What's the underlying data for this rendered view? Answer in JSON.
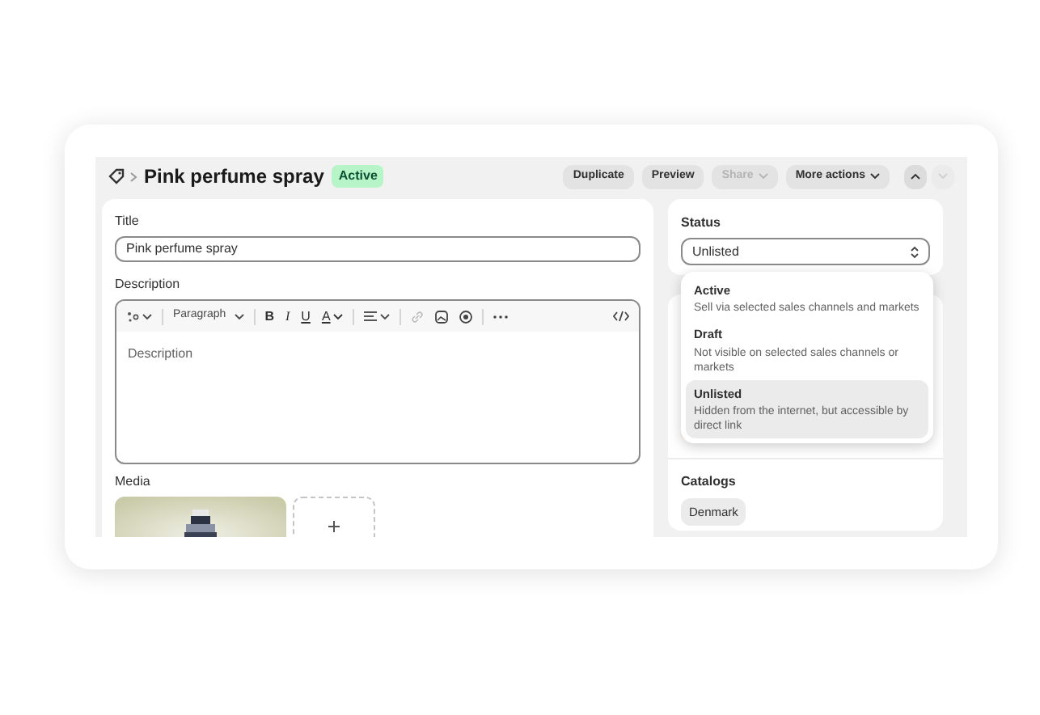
{
  "product": {
    "title": "Pink perfume spray",
    "status_badge": "Active"
  },
  "actions": [
    {
      "label": "Duplicate",
      "kind": "button",
      "disabled": false
    },
    {
      "label": "Preview",
      "kind": "button",
      "disabled": false
    },
    {
      "label": "Share",
      "kind": "menu",
      "disabled": true
    },
    {
      "label": "More actions",
      "kind": "menu",
      "disabled": false
    }
  ],
  "nav_arrows": [
    {
      "kind": "up",
      "disabled": false
    },
    {
      "kind": "down",
      "disabled": true
    }
  ],
  "form": {
    "title_label": "Title",
    "title_value": "Pink perfume spray",
    "description_label": "Description",
    "description_placeholder": "Description",
    "block_style": "Paragraph",
    "format_buttons": [
      "B",
      "I",
      "U",
      "A"
    ],
    "media_label": "Media"
  },
  "status": {
    "label": "Status",
    "value": "Unlisted",
    "options": [
      {
        "label": "Active",
        "description": "Sell via selected sales channels and markets",
        "selected": false
      },
      {
        "label": "Draft",
        "description": "Not visible on selected sales channels or markets",
        "selected": false
      },
      {
        "label": "Unlisted",
        "description": "Hidden from the internet, but accessible by direct link",
        "selected": true
      }
    ]
  },
  "catalogs": {
    "label": "Catalogs",
    "items": [
      "Denmark"
    ]
  }
}
